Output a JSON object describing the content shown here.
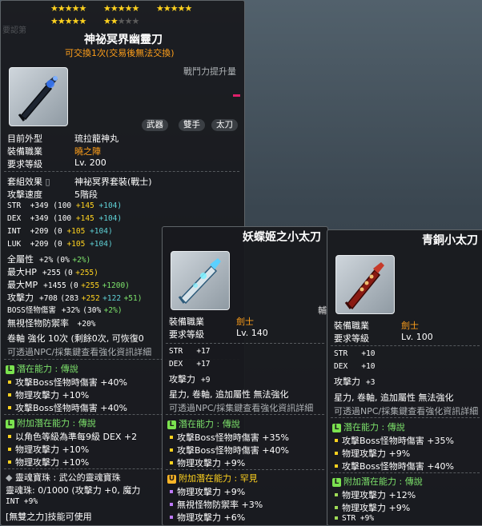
{
  "tooltip_main": {
    "stars_row1": [
      "★★★★★",
      "★★★★★",
      "★★★★★"
    ],
    "stars_row2_on": [
      "★★★★★",
      "★★"
    ],
    "stars_row2_off": "★★★",
    "name": "神祕冥界幽靈刀",
    "trade_note": "可交換1次(交易後無法交換)",
    "compare_header": "戰鬥力提升量",
    "tags": [
      "武器",
      "雙手",
      "太刀"
    ],
    "props": [
      {
        "label": "目前外型",
        "value": "琉拉龍神丸"
      },
      {
        "label": "裝備職業",
        "value": "曉之陣"
      },
      {
        "label": "要求等級",
        "value": "Lv. 200"
      },
      {
        "label": "套組效果",
        "value": "神祕冥界套裝(戰士)"
      },
      {
        "label": "攻擊速度",
        "value": "5階段"
      }
    ],
    "stats": [
      {
        "label": "STR",
        "total": "+349",
        "base": "(100",
        "a": "+145",
        "b": "+104)",
        "c": ""
      },
      {
        "label": "DEX",
        "total": "+349",
        "base": "(100",
        "a": "+145",
        "b": "+104)",
        "c": ""
      },
      {
        "label": "INT",
        "total": "+209",
        "base": "(0",
        "a": "+105",
        "b": "+104)",
        "c": ""
      },
      {
        "label": "LUK",
        "total": "+209",
        "base": "(0",
        "a": "+105",
        "b": "+104)",
        "c": ""
      },
      {
        "label": "全屬性",
        "total": "+2%",
        "base": "(0%",
        "a": "+2%)",
        "b": "",
        "c": ""
      },
      {
        "label": "最大HP",
        "total": "+255",
        "base": "(0",
        "a": "+255)",
        "b": "",
        "c": ""
      },
      {
        "label": "最大MP",
        "total": "+1455",
        "base": "(0",
        "a": "+255",
        "b": "+1200)",
        "c": ""
      },
      {
        "label": "攻擊力",
        "total": "+708",
        "base": "(283",
        "a": "+252",
        "b": "+122",
        "c": "+51)"
      },
      {
        "label": "BOSS怪物傷害",
        "total": "+32%",
        "base": "(30%",
        "a": "+2%)",
        "b": "",
        "c": ""
      },
      {
        "label": "無視怪物防禦率",
        "total": "+20%",
        "base": "",
        "a": "",
        "b": "",
        "c": ""
      }
    ],
    "scroll_line": "卷軸 強化 10次 (剩餘0次, 可恢復0",
    "npc_line": "可透過NPC/採集鍵查看強化資訊詳細",
    "potential_title": "潛在能力 : 傳說",
    "potential_lines": [
      "攻擊Boss怪物時傷害 +40%",
      "物理攻擊力 +10%",
      "攻擊Boss怪物時傷害 +40%"
    ],
    "add_potential_title": "附加潛在能力 : 傳說",
    "add_potential_lines": [
      "以角色等級為準每9級 DEX +2",
      "物理攻擊力 +10%",
      "物理攻擊力 +10%"
    ],
    "soul_title": "靈魂寶珠 : 武公的靈魂寶珠",
    "soul_line": "靈魂珠: 0/1000 (攻擊力 +0, 魔力",
    "soul_int": "INT +9%",
    "skill_line": "[無雙之力]技能可使用",
    "bg_text_top": "要認第"
  },
  "tooltip_mid": {
    "name": "妖蝶姬之小太刀",
    "props": [
      {
        "label": "裝備職業",
        "value": "劍士"
      },
      {
        "label": "要求等級",
        "value": "Lv. 140"
      }
    ],
    "stats": [
      {
        "label": "STR",
        "value": "+17"
      },
      {
        "label": "DEX",
        "value": "+17"
      },
      {
        "label": "攻擊力",
        "value": "+9"
      }
    ],
    "flags": "星力, 卷軸, 追加屬性 無法強化",
    "npc_line": "可透過NPC/採集鍵查看強化資訊詳細",
    "potential_title": "潛在能力 : 傳說",
    "potential_lines": [
      "攻擊Boss怪物時傷害 +35%",
      "攻擊Boss怪物時傷害 +40%",
      "物理攻擊力 +9%"
    ],
    "add_potential_title": "附加潛在能力 : 罕見",
    "add_potential_lines": [
      "物理攻擊力 +9%",
      "無視怪物防禦率 +3%",
      "物理攻擊力 +6%"
    ],
    "edge_label": "輔"
  },
  "tooltip_right": {
    "name": "青銅小太刀",
    "props": [
      {
        "label": "裝備職業",
        "value": "劍士"
      },
      {
        "label": "要求等級",
        "value": "Lv. 100"
      }
    ],
    "stats": [
      {
        "label": "STR",
        "value": "+10"
      },
      {
        "label": "DEX",
        "value": "+10"
      },
      {
        "label": "攻擊力",
        "value": "+3"
      }
    ],
    "flags": "星力, 卷軸, 追加屬性 無法強化",
    "npc_line": "可透過NPC/採集鍵查看強化資訊詳細",
    "potential_title": "潛在能力 : 傳說",
    "potential_lines": [
      "攻擊Boss怪物時傷害 +35%",
      "物理攻擊力 +9%",
      "攻擊Boss怪物時傷害 +40%"
    ],
    "add_potential_title": "附加潛在能力 : 傳說",
    "add_potential_lines": [
      "物理攻擊力 +12%",
      "物理攻擊力 +9%",
      "STR +9%"
    ]
  },
  "colors": {
    "star": "#ffd21f",
    "orange": "#ff9f1a",
    "green": "#7de36b",
    "legend_badge": "#7be24f",
    "rare_badge": "#ffb627"
  }
}
